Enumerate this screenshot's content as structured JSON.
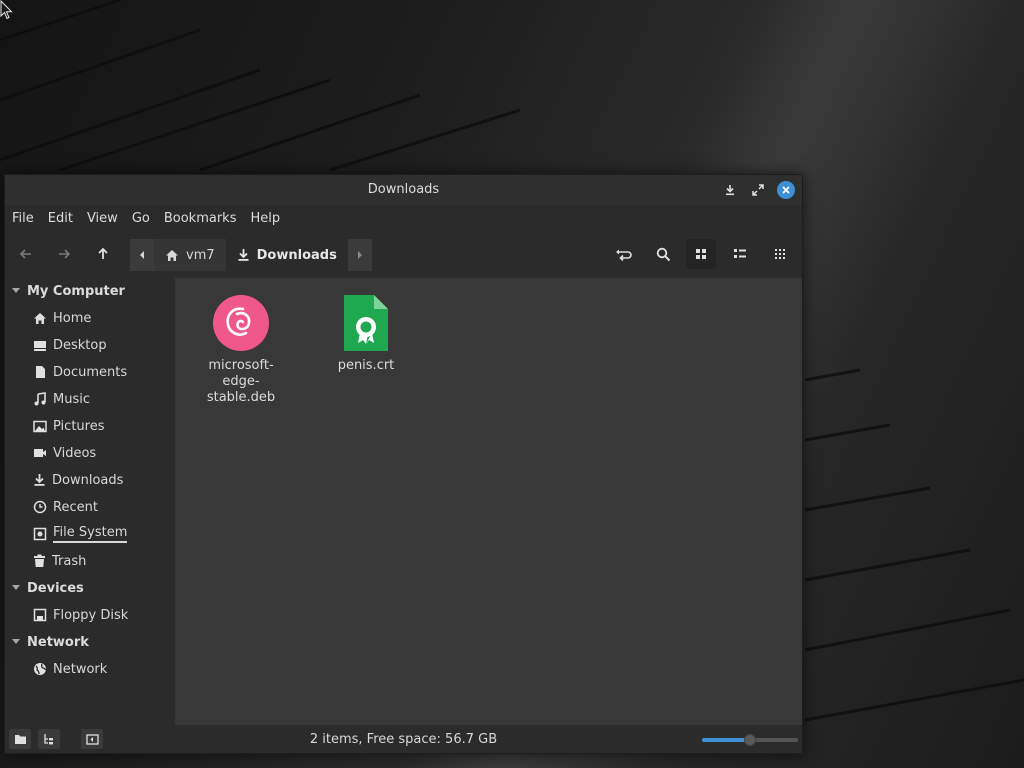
{
  "window": {
    "title": "Downloads"
  },
  "menubar": {
    "items": [
      "File",
      "Edit",
      "View",
      "Go",
      "Bookmarks",
      "Help"
    ]
  },
  "breadcrumb": {
    "items": [
      {
        "label": "vm7",
        "icon": "home-icon"
      },
      {
        "label": "Downloads",
        "icon": "download-icon"
      }
    ]
  },
  "sidebar": {
    "sections": [
      {
        "title": "My Computer",
        "items": [
          "Home",
          "Desktop",
          "Documents",
          "Music",
          "Pictures",
          "Videos",
          "Downloads",
          "Recent",
          "File System",
          "Trash"
        ]
      },
      {
        "title": "Devices",
        "items": [
          "Floppy Disk"
        ]
      },
      {
        "title": "Network",
        "items": [
          "Network"
        ]
      }
    ]
  },
  "files": [
    {
      "name": "microsoft-edge-stable.deb",
      "icon": "debian-package-icon",
      "color": "#f0588c"
    },
    {
      "name": "penis.crt",
      "icon": "certificate-file-icon",
      "color": "#1fa84f"
    }
  ],
  "status": {
    "text": "2 items, Free space: 56.7 GB",
    "zoom_level": 0.5
  },
  "colors": {
    "accent": "#3d8fd6"
  }
}
